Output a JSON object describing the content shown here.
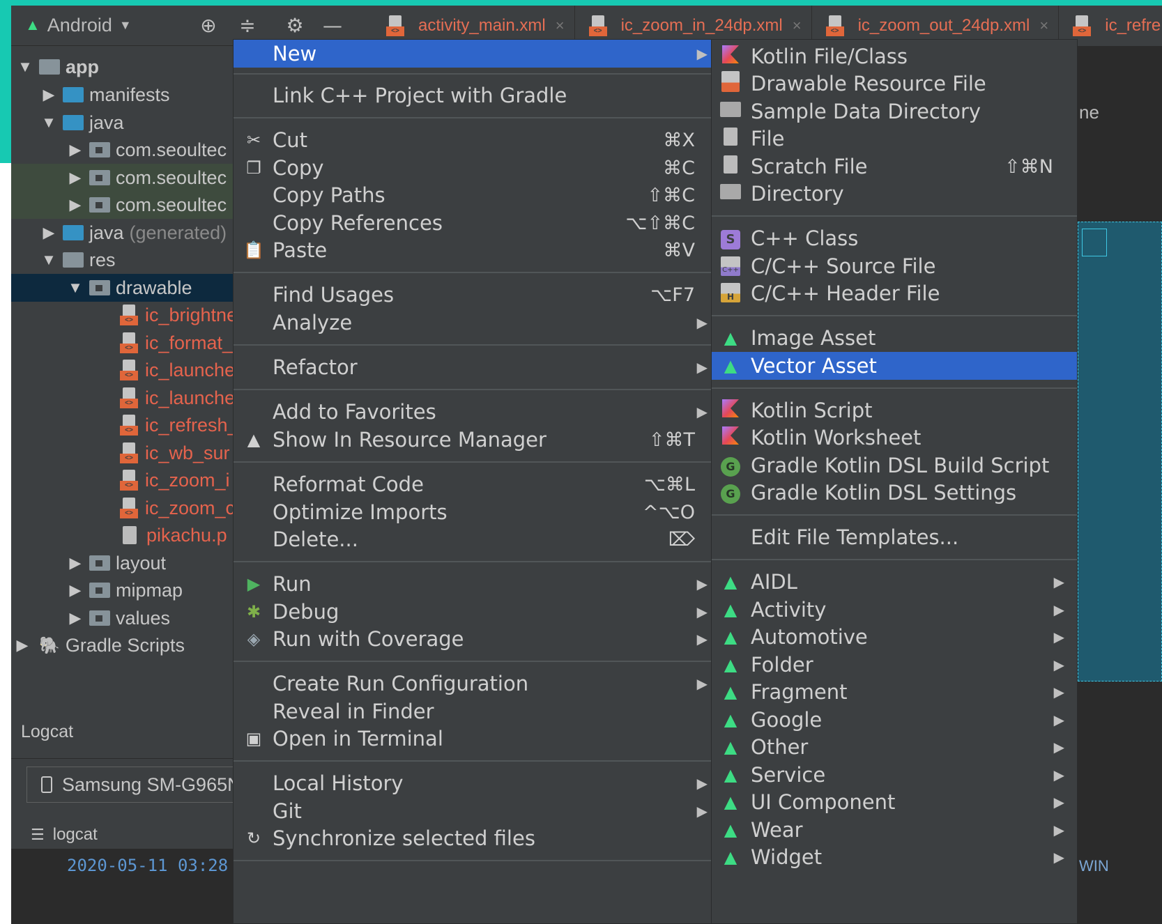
{
  "toolbar": {
    "view_mode": "Android",
    "tabs": [
      {
        "label": "activity_main.xml"
      },
      {
        "label": "ic_zoom_in_24dp.xml"
      },
      {
        "label": "ic_zoom_out_24dp.xml"
      },
      {
        "label": "ic_refre"
      }
    ],
    "tab_close_glyph": "×"
  },
  "tree": {
    "app": "app",
    "manifests": "manifests",
    "java": "java",
    "pkg1": "com.seoultec",
    "pkg2": "com.seoultec",
    "pkg3": "com.seoultec",
    "java_generated": "java",
    "java_generated_suffix": "(generated)",
    "res": "res",
    "drawable": "drawable",
    "drawable_files": [
      "ic_brightne",
      "ic_format_",
      "ic_launche",
      "ic_launche",
      "ic_refresh_",
      "ic_wb_sur",
      "ic_zoom_i",
      "ic_zoom_c",
      "pikachu.p"
    ],
    "layout": "layout",
    "mipmap": "mipmap",
    "values": "values",
    "gradle_scripts": "Gradle Scripts"
  },
  "logcat": {
    "title": "Logcat",
    "device": "Samsung SM-G965N",
    "tab": "logcat",
    "log_line": "2020-05-11 03:28"
  },
  "editor": {
    "partial_text": "ne",
    "bottom_text": "WIN"
  },
  "menu_main": {
    "new": "New",
    "link_cpp": "Link C++ Project with Gradle",
    "cut": "Cut",
    "cut_sc": "⌘X",
    "copy": "Copy",
    "copy_sc": "⌘C",
    "copy_paths": "Copy Paths",
    "copy_paths_sc": "⇧⌘C",
    "copy_refs": "Copy References",
    "copy_refs_sc": "⌥⇧⌘C",
    "paste": "Paste",
    "paste_sc": "⌘V",
    "find_usages": "Find Usages",
    "find_usages_sc": "⌥F7",
    "analyze": "Analyze",
    "refactor": "Refactor",
    "add_favorites": "Add to Favorites",
    "show_resource": "Show In Resource Manager",
    "show_resource_sc": "⇧⌘T",
    "reformat": "Reformat Code",
    "reformat_sc": "⌥⌘L",
    "optimize": "Optimize Imports",
    "optimize_sc": "^⌥O",
    "delete": "Delete...",
    "delete_sc": "⌦",
    "run": "Run",
    "debug": "Debug",
    "run_coverage": "Run with Coverage",
    "create_run": "Create Run Configuration",
    "reveal_finder": "Reveal in Finder",
    "open_terminal": "Open in Terminal",
    "local_history": "Local History",
    "git": "Git",
    "sync": "Synchronize selected files"
  },
  "menu_new": {
    "kotlin_file": "Kotlin File/Class",
    "drawable_res": "Drawable Resource File",
    "sample_data": "Sample Data Directory",
    "file": "File",
    "scratch": "Scratch File",
    "scratch_sc": "⇧⌘N",
    "directory": "Directory",
    "cpp_class": "C++ Class",
    "cpp_source": "C/C++ Source File",
    "cpp_header": "C/C++ Header File",
    "image_asset": "Image Asset",
    "vector_asset": "Vector Asset",
    "kotlin_script": "Kotlin Script",
    "kotlin_worksheet": "Kotlin Worksheet",
    "gradle_build": "Gradle Kotlin DSL Build Script",
    "gradle_settings": "Gradle Kotlin DSL Settings",
    "edit_templates": "Edit File Templates...",
    "aidl": "AIDL",
    "activity": "Activity",
    "automotive": "Automotive",
    "folder": "Folder",
    "fragment": "Fragment",
    "google": "Google",
    "other": "Other",
    "service": "Service",
    "ui_component": "UI Component",
    "wear": "Wear",
    "widget": "Widget"
  },
  "icon_letters": {
    "cpp_class": "S",
    "cpp_source": "C++",
    "cpp_header": "H",
    "gradle": "G"
  },
  "colors": {
    "accent": "#2f65ca",
    "menu_bg": "#3c3f41",
    "android_green": "#3ddc84",
    "modified_file": "#e5634d",
    "teal": "#17c9b2"
  }
}
